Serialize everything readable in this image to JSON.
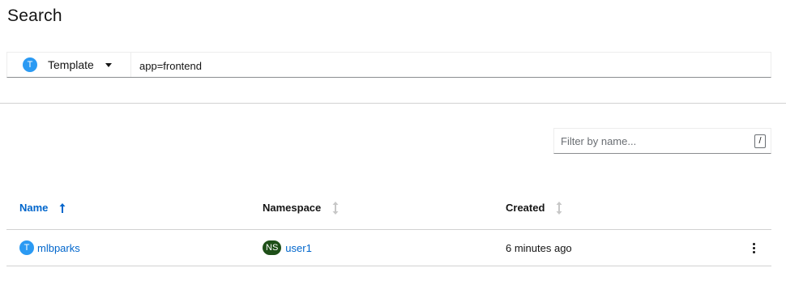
{
  "page": {
    "title": "Search"
  },
  "search": {
    "kind_badge": "T",
    "kind_label": "Template",
    "label_value": "app=frontend"
  },
  "filter": {
    "placeholder": "Filter by name...",
    "shortcut": "/"
  },
  "table": {
    "columns": [
      {
        "label": "Name",
        "sorted": "asc"
      },
      {
        "label": "Namespace",
        "sorted": "none"
      },
      {
        "label": "Created",
        "sorted": "none"
      }
    ],
    "rows": [
      {
        "name_badge": "T",
        "name": "mlbparks",
        "ns_badge": "NS",
        "namespace": "user1",
        "created": "6 minutes ago"
      }
    ]
  },
  "colors": {
    "link": "#0066cc",
    "template_badge": "#2b9af3",
    "namespace_badge": "#1e4f18"
  }
}
